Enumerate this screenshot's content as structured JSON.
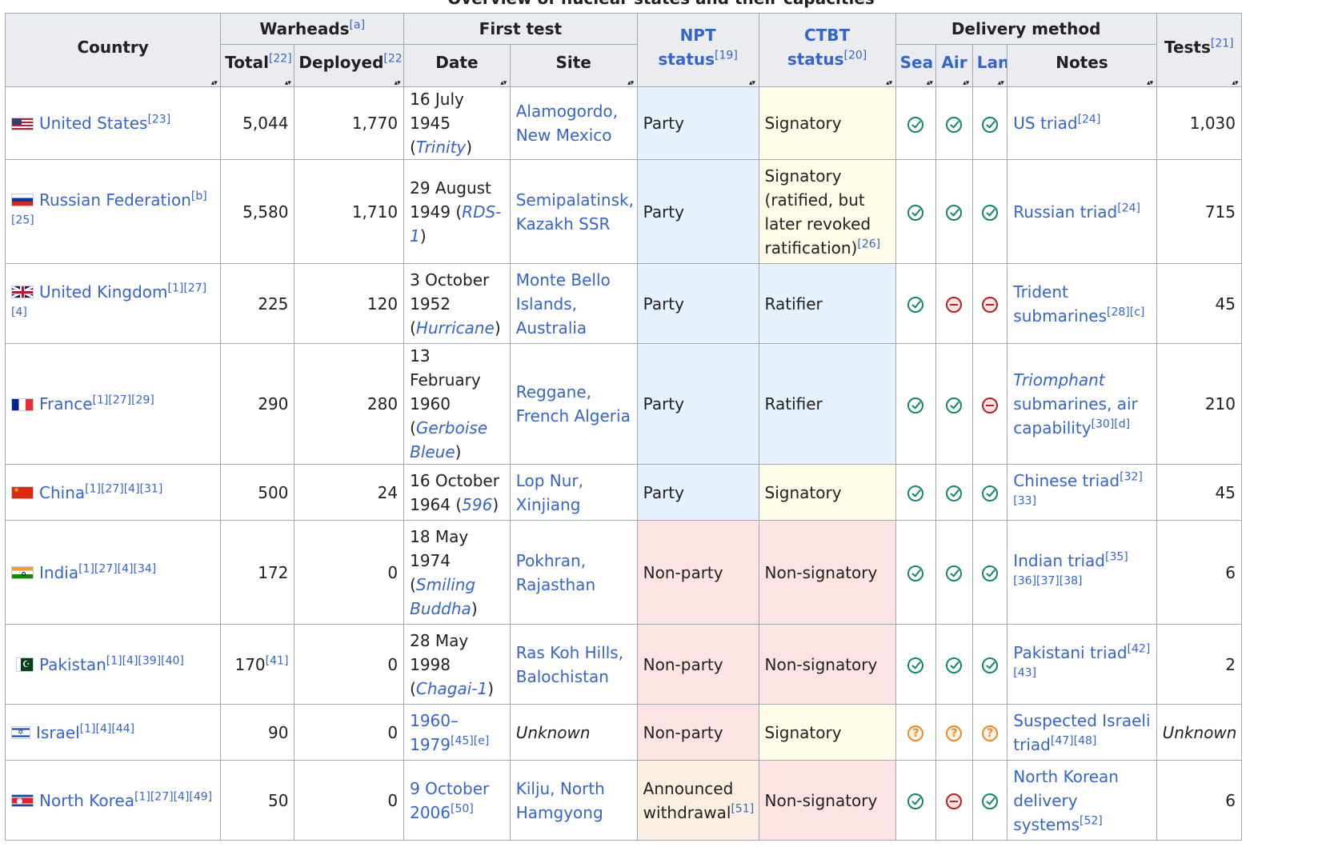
{
  "caption": "Overview of nuclear states and their capacities",
  "headers": {
    "country": "Country",
    "warheads": "Warheads",
    "warheads_ref": "[a]",
    "total": "Total",
    "total_ref": "[22]",
    "deployed": "Deployed",
    "deployed_ref": "[22]",
    "first_test": "First test",
    "date": "Date",
    "site": "Site",
    "npt": "NPT status",
    "npt_ref": "[19]",
    "ctbt": "CTBT status",
    "ctbt_ref": "[20]",
    "delivery": "Delivery method",
    "sea": "Sea",
    "air": "Air",
    "land": "Land",
    "notes": "Notes",
    "tests": "Tests",
    "tests_ref": "[21]"
  },
  "rows": [
    {
      "flag": "us-flag",
      "country": "United States",
      "country_refs": "[23]",
      "total": "5,044",
      "total_refs": "",
      "deployed": "1,770",
      "date": "16 July 1945",
      "test_name": "Trinity",
      "site": "Alamogordo, New Mexico",
      "npt": "Party",
      "npt_class": "npt-party",
      "ctbt": "Signatory",
      "ctbt_class": "ctbt-sig",
      "sea": "yes",
      "air": "yes",
      "land": "yes",
      "notes": "US triad",
      "notes_italic": "",
      "notes_refs": "[24]",
      "tests": "1,030"
    },
    {
      "flag": "ru-flag",
      "country": "Russian Federation",
      "country_refs": "[b][25]",
      "total": "5,580",
      "total_refs": "",
      "deployed": "1,710",
      "date": "29 August 1949",
      "test_name": "RDS-1",
      "site": "Semipalatinsk, Kazakh SSR",
      "npt": "Party",
      "npt_class": "npt-party",
      "ctbt": "Signatory (ratified, but later revoked ratification)",
      "ctbt_refs": "[26]",
      "ctbt_class": "ctbt-sig",
      "sea": "yes",
      "air": "yes",
      "land": "yes",
      "notes": "Russian triad",
      "notes_italic": "",
      "notes_refs": "[24]",
      "tests": "715"
    },
    {
      "flag": "uk-flag",
      "country": "United Kingdom",
      "country_refs": "[1][27][4]",
      "total": "225",
      "total_refs": "",
      "deployed": "120",
      "date": "3 October 1952",
      "test_name": "Hurricane",
      "site": "Monte Bello Islands, Australia",
      "npt": "Party",
      "npt_class": "npt-party",
      "ctbt": "Ratifier",
      "ctbt_class": "ctbt-rat",
      "sea": "yes",
      "air": "no",
      "land": "no",
      "notes": "Trident submarines",
      "notes_italic": "",
      "notes_refs": "[28][c]",
      "tests": "45"
    },
    {
      "flag": "fr-flag",
      "country": "France",
      "country_refs": "[1][27][29]",
      "total": "290",
      "total_refs": "",
      "deployed": "280",
      "date": "13 February 1960",
      "test_name": "Gerboise Bleue",
      "site": "Reggane, French Algeria",
      "npt": "Party",
      "npt_class": "npt-party",
      "ctbt": "Ratifier",
      "ctbt_class": "ctbt-rat",
      "sea": "yes",
      "air": "yes",
      "land": "no",
      "notes": " submarines, air capability",
      "notes_italic": "Triomphant",
      "notes_refs": "[30][d]",
      "tests": "210"
    },
    {
      "flag": "cn-flag",
      "country": "China",
      "country_refs": "[1][27][4][31]",
      "total": "500",
      "total_refs": "",
      "deployed": "24",
      "date": "16 October 1964",
      "test_name": "596",
      "site": "Lop Nur, Xinjiang",
      "npt": "Party",
      "npt_class": "npt-party",
      "ctbt": "Signatory",
      "ctbt_class": "ctbt-sig",
      "sea": "yes",
      "air": "yes",
      "land": "yes",
      "notes": "Chinese triad",
      "notes_italic": "",
      "notes_refs": "[32][33]",
      "tests": "45"
    },
    {
      "flag": "in-flag",
      "country": "India",
      "country_refs": "[1][27][4][34]",
      "total": "172",
      "total_refs": "",
      "deployed": "0",
      "date": "18 May 1974",
      "test_name": "Smiling Buddha",
      "site": "Pokhran, Rajasthan",
      "npt": "Non-party",
      "npt_class": "npt-non",
      "ctbt": "Non-signatory",
      "ctbt_class": "ctbt-non",
      "sea": "yes",
      "air": "yes",
      "land": "yes",
      "notes": "Indian triad",
      "notes_italic": "",
      "notes_refs": "[35][36][37][38]",
      "tests": "6"
    },
    {
      "flag": "pk-flag",
      "country": "Pakistan",
      "country_refs": "[1][4][39][40]",
      "total": "170",
      "total_refs": "[41]",
      "deployed": "0",
      "date": "28 May 1998",
      "test_name": "Chagai-1",
      "site": "Ras Koh Hills, Balochistan",
      "npt": "Non-party",
      "npt_class": "npt-non",
      "ctbt": "Non-signatory",
      "ctbt_class": "ctbt-non",
      "sea": "yes",
      "air": "yes",
      "land": "yes",
      "notes": "Pakistani triad",
      "notes_italic": "",
      "notes_refs": "[42][43]",
      "tests": "2"
    },
    {
      "flag": "il-flag",
      "country": "Israel",
      "country_refs": "[1][4][44]",
      "total": "90",
      "total_refs": "",
      "deployed": "0",
      "date": "1960–1979",
      "date_refs": "[45][e]",
      "test_name": "",
      "site": "Unknown",
      "site_italic": true,
      "npt": "Non-party",
      "npt_class": "npt-non",
      "ctbt": "Signatory",
      "ctbt_class": "ctbt-sig",
      "sea": "unknown",
      "air": "unknown",
      "land": "unknown",
      "notes": "Suspected Israeli triad",
      "notes_italic": "",
      "notes_refs": "[47][48]",
      "tests": "Unknown",
      "tests_italic": true
    },
    {
      "flag": "kp-flag",
      "country": "North Korea",
      "country_refs": "[1][27][4][49]",
      "total": "50",
      "total_refs": "",
      "deployed": "0",
      "date": "9 October 2006",
      "date_refs": "[50]",
      "test_name": "",
      "site": "Kilju, North Hamgyong",
      "npt": "Announced withdrawal",
      "npt_refs": "[51]",
      "npt_class": "npt-ann",
      "ctbt": "Non-signatory",
      "ctbt_class": "ctbt-non",
      "sea": "yes",
      "air": "no",
      "land": "yes",
      "notes": "North Korean delivery systems",
      "notes_italic": "",
      "notes_refs": "[52]",
      "tests": "6"
    }
  ]
}
